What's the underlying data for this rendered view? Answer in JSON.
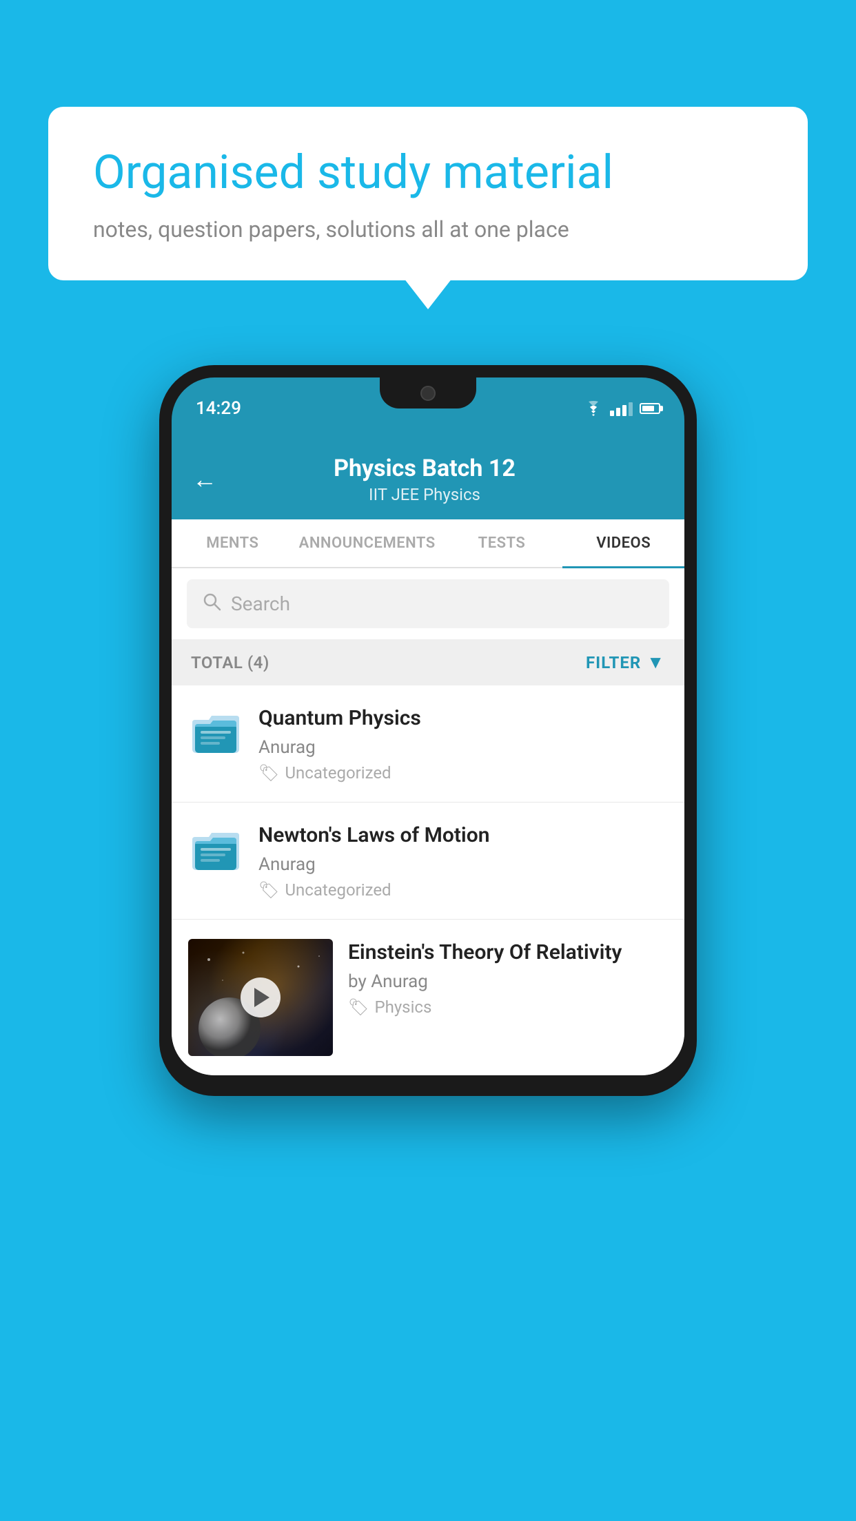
{
  "background": {
    "color": "#1ab8e8"
  },
  "speech_bubble": {
    "title": "Organised study material",
    "subtitle": "notes, question papers, solutions all at one place"
  },
  "phone": {
    "status_bar": {
      "time": "14:29"
    },
    "header": {
      "title": "Physics Batch 12",
      "subtitle": "IIT JEE   Physics",
      "back_label": "←"
    },
    "tabs": [
      {
        "label": "MENTS",
        "active": false
      },
      {
        "label": "ANNOUNCEMENTS",
        "active": false
      },
      {
        "label": "TESTS",
        "active": false
      },
      {
        "label": "VIDEOS",
        "active": true
      }
    ],
    "search": {
      "placeholder": "Search"
    },
    "filter_bar": {
      "total_label": "TOTAL (4)",
      "filter_label": "FILTER"
    },
    "videos": [
      {
        "title": "Quantum Physics",
        "author": "Anurag",
        "tag": "Uncategorized",
        "type": "folder"
      },
      {
        "title": "Newton's Laws of Motion",
        "author": "Anurag",
        "tag": "Uncategorized",
        "type": "folder"
      },
      {
        "title": "Einstein's Theory Of Relativity",
        "author": "by Anurag",
        "tag": "Physics",
        "type": "video"
      }
    ]
  }
}
